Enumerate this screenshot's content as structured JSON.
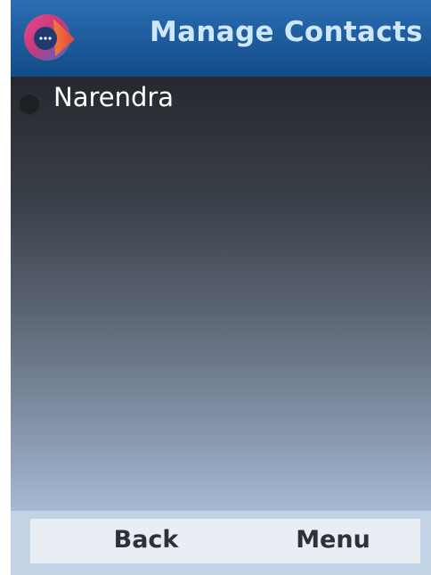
{
  "header": {
    "title": "Manage Contacts",
    "icon": "app-logo-icon"
  },
  "contacts": [
    {
      "name": "Narendra",
      "selected": false
    }
  ],
  "softkeys": {
    "left": "Back",
    "right": "Menu"
  },
  "colors": {
    "header": "#1f5e9f",
    "title_text": "#cfe6ff",
    "softkey_bar": "#e9eef4"
  }
}
